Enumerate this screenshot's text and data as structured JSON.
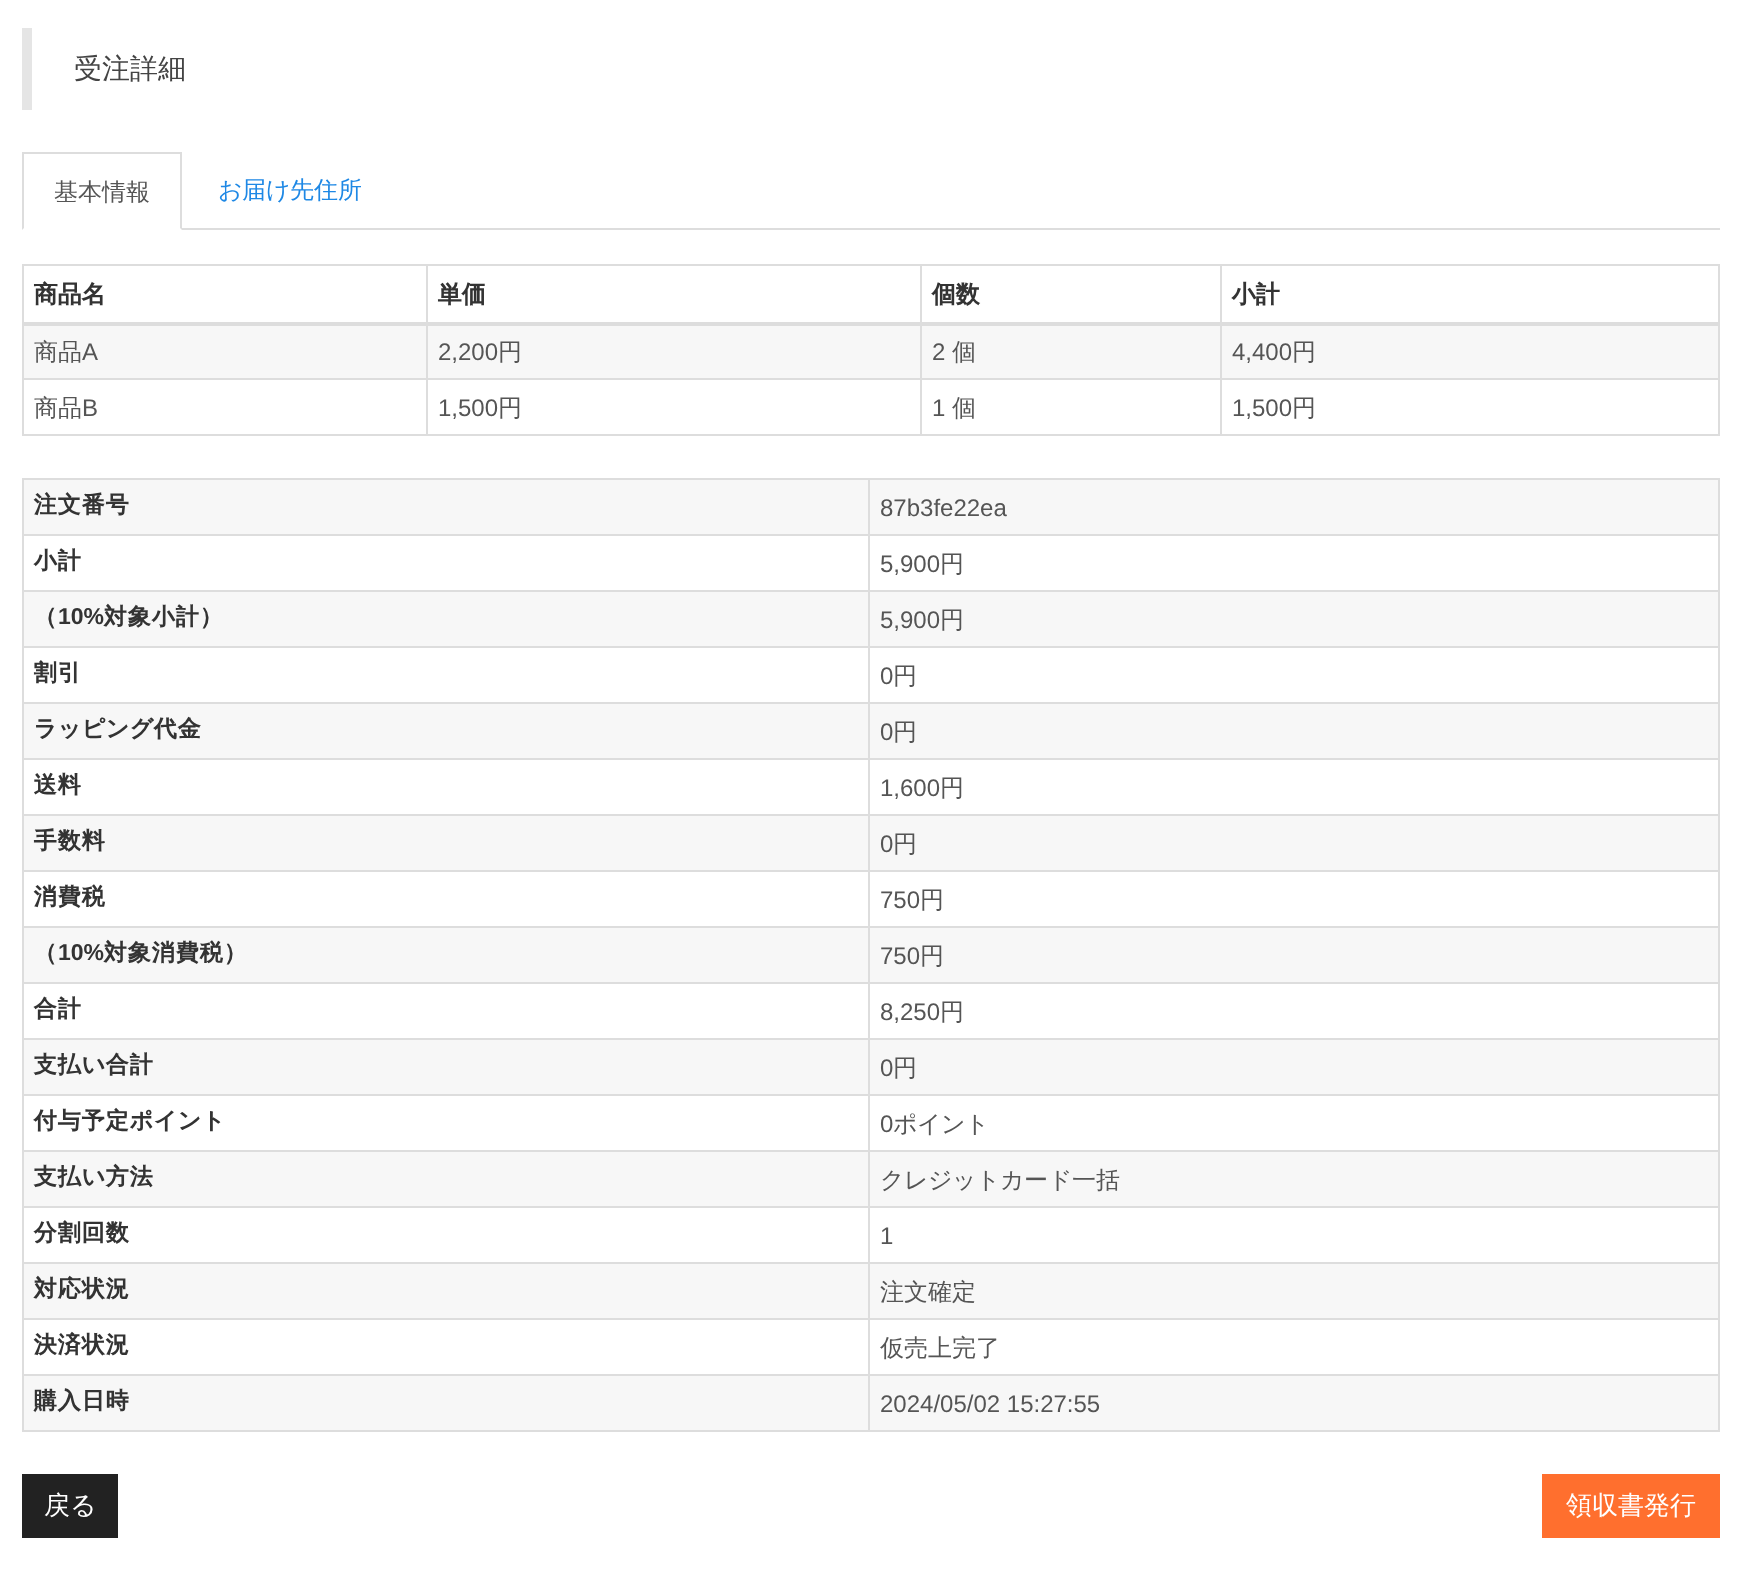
{
  "title": "受注詳細",
  "tabs": [
    {
      "label": "基本情報",
      "selected": true
    },
    {
      "label": "お届け先住所",
      "selected": false
    }
  ],
  "items_table": {
    "columns": [
      "商品名",
      "単価",
      "個数",
      "小計"
    ],
    "rows": [
      [
        "商品A",
        "2,200円",
        "2 個",
        "4,400円"
      ],
      [
        "商品B",
        "1,500円",
        "1 個",
        "1,500円"
      ]
    ]
  },
  "details": [
    {
      "label": "注文番号",
      "value": "87b3fe22ea"
    },
    {
      "label": "小計",
      "value": "5,900円"
    },
    {
      "label": "（10%対象小計）",
      "value": "5,900円"
    },
    {
      "label": "割引",
      "value": "0円"
    },
    {
      "label": "ラッピング代金",
      "value": "0円"
    },
    {
      "label": "送料",
      "value": "1,600円"
    },
    {
      "label": "手数料",
      "value": "0円"
    },
    {
      "label": "消費税",
      "value": "750円"
    },
    {
      "label": "（10%対象消費税）",
      "value": "750円"
    },
    {
      "label": "合計",
      "value": "8,250円"
    },
    {
      "label": "支払い合計",
      "value": "0円"
    },
    {
      "label": "付与予定ポイント",
      "value": "0ポイント"
    },
    {
      "label": "支払い方法",
      "value": "クレジットカード一括"
    },
    {
      "label": "分割回数",
      "value": "1"
    },
    {
      "label": "対応状況",
      "value": "注文確定"
    },
    {
      "label": "決済状況",
      "value": "仮売上完了"
    },
    {
      "label": "購入日時",
      "value": "2024/05/02 15:27:55"
    }
  ],
  "buttons": {
    "back": "戻る",
    "receipt": "領収書発行"
  }
}
